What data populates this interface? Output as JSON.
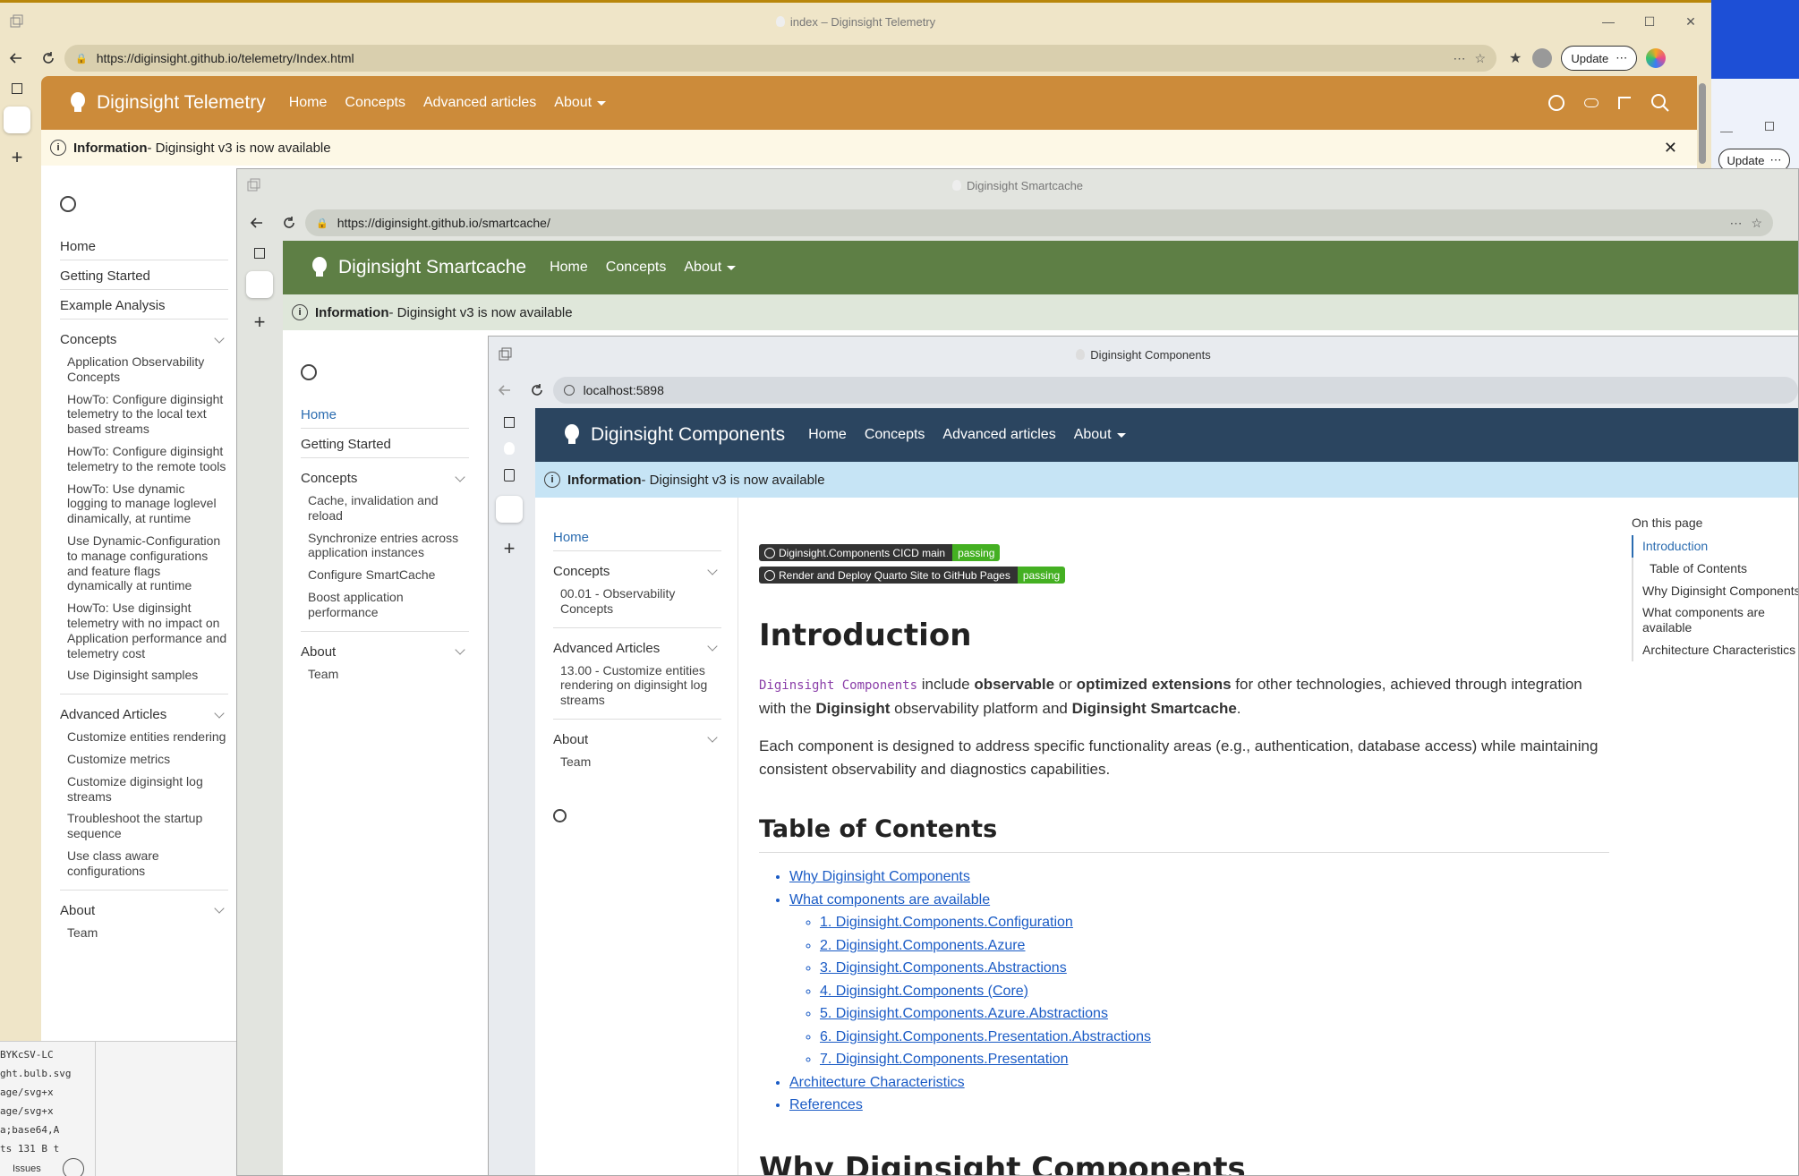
{
  "desktop_bg": "#1d4fd6",
  "bg_window": {
    "update_label": "Update",
    "update_more": "⋯"
  },
  "win1": {
    "title": "index – Diginsight Telemetry",
    "url": "https://diginsight.github.io/telemetry/Index.html",
    "update_label": "Update",
    "site": {
      "brand": "Diginsight Telemetry",
      "nav": [
        "Home",
        "Concepts",
        "Advanced articles",
        "About"
      ],
      "header_color": "#cc8b3a",
      "info_bold": "Information",
      "info_text": " - Diginsight v3 is now available",
      "info_bg": "#fdf8e6"
    },
    "sidebar": {
      "top_items": [
        "Home",
        "Getting Started",
        "Example Analysis"
      ],
      "concepts_title": "Concepts",
      "concepts_items": [
        "Application Observability Concepts",
        "HowTo: Configure diginsight telemetry to the local text based streams",
        "HowTo: Configure diginsight telemetry to the remote tools",
        "HowTo: Use dynamic logging to manage loglevel dinamically, at runtime",
        "Use Dynamic-Configuration to manage configurations and feature flags dynamically at runtime",
        "HowTo: Use diginsight telemetry with no impact on Application performance and telemetry cost",
        "Use Diginsight samples"
      ],
      "advanced_title": "Advanced Articles",
      "advanced_items": [
        "Customize entities rendering",
        "Customize metrics",
        "Customize diginsight log streams",
        "Troubleshoot the startup sequence",
        "Use class aware configurations"
      ],
      "about_title": "About",
      "about_items": [
        "Team"
      ]
    },
    "devtools_lines": [
      "BYKcSV-LC",
      "ght.bulb.svg",
      "age/svg+x",
      "age/svg+x",
      "a;base64,A",
      "ts  131 B t"
    ],
    "devtools_tab": "Issues"
  },
  "win2": {
    "title": "Diginsight Smartcache",
    "url": "https://diginsight.github.io/smartcache/",
    "site": {
      "brand": "Diginsight Smartcache",
      "nav": [
        "Home",
        "Concepts",
        "About"
      ],
      "header_color": "#5e7f45",
      "info_bold": "Information",
      "info_text": " - Diginsight v3 is now available",
      "info_bg": "#dfe7da"
    },
    "sidebar": {
      "top_items": [
        "Home",
        "Getting Started"
      ],
      "concepts_title": "Concepts",
      "concepts_items": [
        "Cache, invalidation and reload",
        "Synchronize entries across application instances",
        "Configure SmartCache",
        "Boost application performance"
      ],
      "about_title": "About",
      "about_items": [
        "Team"
      ]
    }
  },
  "win3": {
    "title": "Diginsight Components",
    "url": "localhost:5898",
    "site": {
      "brand": "Diginsight Components",
      "nav": [
        "Home",
        "Concepts",
        "Advanced articles",
        "About"
      ],
      "header_color": "#2b4560",
      "info_bold": "Information",
      "info_text": " - Diginsight v3 is now available",
      "info_bg": "#c6e4f5"
    },
    "sidebar": {
      "top_items": [
        "Home"
      ],
      "concepts_title": "Concepts",
      "concepts_items": [
        "00.01 - Observability Concepts"
      ],
      "advanced_title": "Advanced Articles",
      "advanced_items": [
        "13.00 - Customize entities rendering on diginsight log streams"
      ],
      "about_title": "About",
      "about_items": [
        "Team"
      ]
    },
    "badges": [
      {
        "label": "Diginsight.Components CICD main",
        "status": "passing"
      },
      {
        "label": "Render and Deploy Quarto Site to GitHub Pages",
        "status": "passing"
      }
    ],
    "content": {
      "h1": "Introduction",
      "p1_code": "Diginsight Components",
      "p1_a": " include ",
      "p1_b1": "observable",
      "p1_c": " or ",
      "p1_b2": "optimized extensions",
      "p1_d": " for other technologies, achieved through integration with the ",
      "p1_b3": "Diginsight",
      "p1_e": " observability platform and ",
      "p1_b4": "Diginsight Smartcache",
      "p1_f": ".",
      "p2": "Each component is designed to address specific functionality areas (e.g., authentication, database access) while maintaining consistent observability and diagnostics capabilities.",
      "h2_toc": "Table of Contents",
      "toc": {
        "why": "Why Diginsight Components",
        "what": "What components are available",
        "sub": [
          "1. Diginsight.Components.Configuration",
          "2. Diginsight.Components.Azure",
          "3. Diginsight.Components.Abstractions",
          "4. Diginsight.Components (Core)",
          "5. Diginsight.Components.Azure.Abstractions",
          "6. Diginsight.Components.Presentation.Abstractions",
          "7. Diginsight.Components.Presentation"
        ],
        "arch": "Architecture Characteristics",
        "refs": "References"
      },
      "h2_why": "Why Diginsight Components"
    },
    "on_this_page": {
      "title": "On this page",
      "items": [
        "Introduction",
        "Table of Contents",
        "Why Diginsight Components",
        "What components are available",
        "Architecture Characteristics"
      ]
    }
  }
}
